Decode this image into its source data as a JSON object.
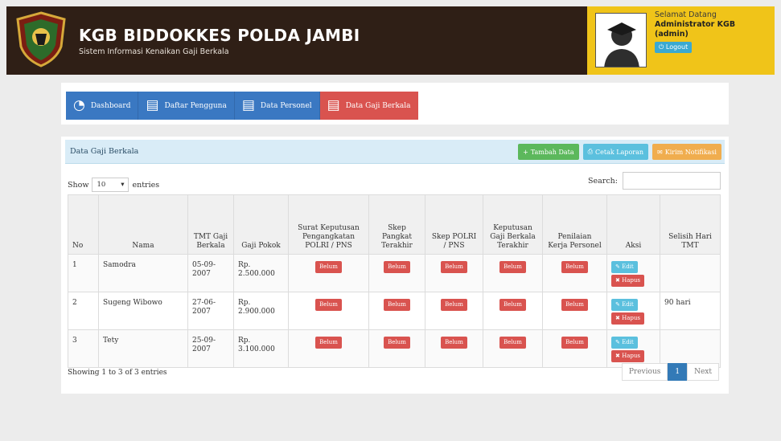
{
  "header": {
    "title": "KGB BIDDOKKES POLDA JAMBI",
    "subtitle": "Sistem Informasi Kenaikan Gaji Berkala"
  },
  "user": {
    "greeting": "Selamat Datang",
    "name": "Administrator KGB (admin)",
    "logout_label": "Logout"
  },
  "nav": {
    "tabs": [
      {
        "label": "Dashboard",
        "icon": "dashboard-icon"
      },
      {
        "label": "Daftar Pengguna",
        "icon": "list-icon"
      },
      {
        "label": "Data Personel",
        "icon": "list-icon"
      },
      {
        "label": "Data Gaji Berkala",
        "icon": "list-icon"
      }
    ]
  },
  "panel": {
    "title": "Data Gaji Berkala",
    "add_label": "Tambah Data",
    "print_label": "Cetak Laporan",
    "notif_label": "Kirim Notifikasi"
  },
  "table_controls": {
    "show": "Show",
    "entries_value": "10",
    "entries": "entries",
    "search": "Search:"
  },
  "table": {
    "headers": [
      "No",
      "Nama",
      "TMT Gaji Berkala",
      "Gaji Pokok",
      "Surat Keputusan Pengangkatan POLRI / PNS",
      "Skep Pangkat Terakhir",
      "Skep POLRI / PNS",
      "Keputusan Gaji Berkala Terakhir",
      "Penilaian Kerja Personel",
      "Aksi",
      "Selisih Hari TMT"
    ],
    "rows": [
      {
        "no": "1",
        "nama": "Samodra",
        "tmt": "05-09-2007",
        "gaji": "Rp. 2.500.000",
        "selisih": ""
      },
      {
        "no": "2",
        "nama": "Sugeng Wibowo",
        "tmt": "27-06-2007",
        "gaji": "Rp. 2.900.000",
        "selisih": "90 hari"
      },
      {
        "no": "3",
        "nama": "Tety",
        "tmt": "25-09-2007",
        "gaji": "Rp. 3.100.000",
        "selisih": ""
      }
    ],
    "belum": "Belum",
    "edit": "Edit",
    "hapus": "Hapus"
  },
  "footer": {
    "info": "Showing 1 to 3 of 3 entries",
    "prev": "Previous",
    "page": "1",
    "next": "Next"
  },
  "colors": {
    "header_bg": "#2f1f16",
    "user_panel_bg": "#f0c419",
    "nav_blue": "#3a78c2",
    "nav_active_red": "#d9534f"
  }
}
